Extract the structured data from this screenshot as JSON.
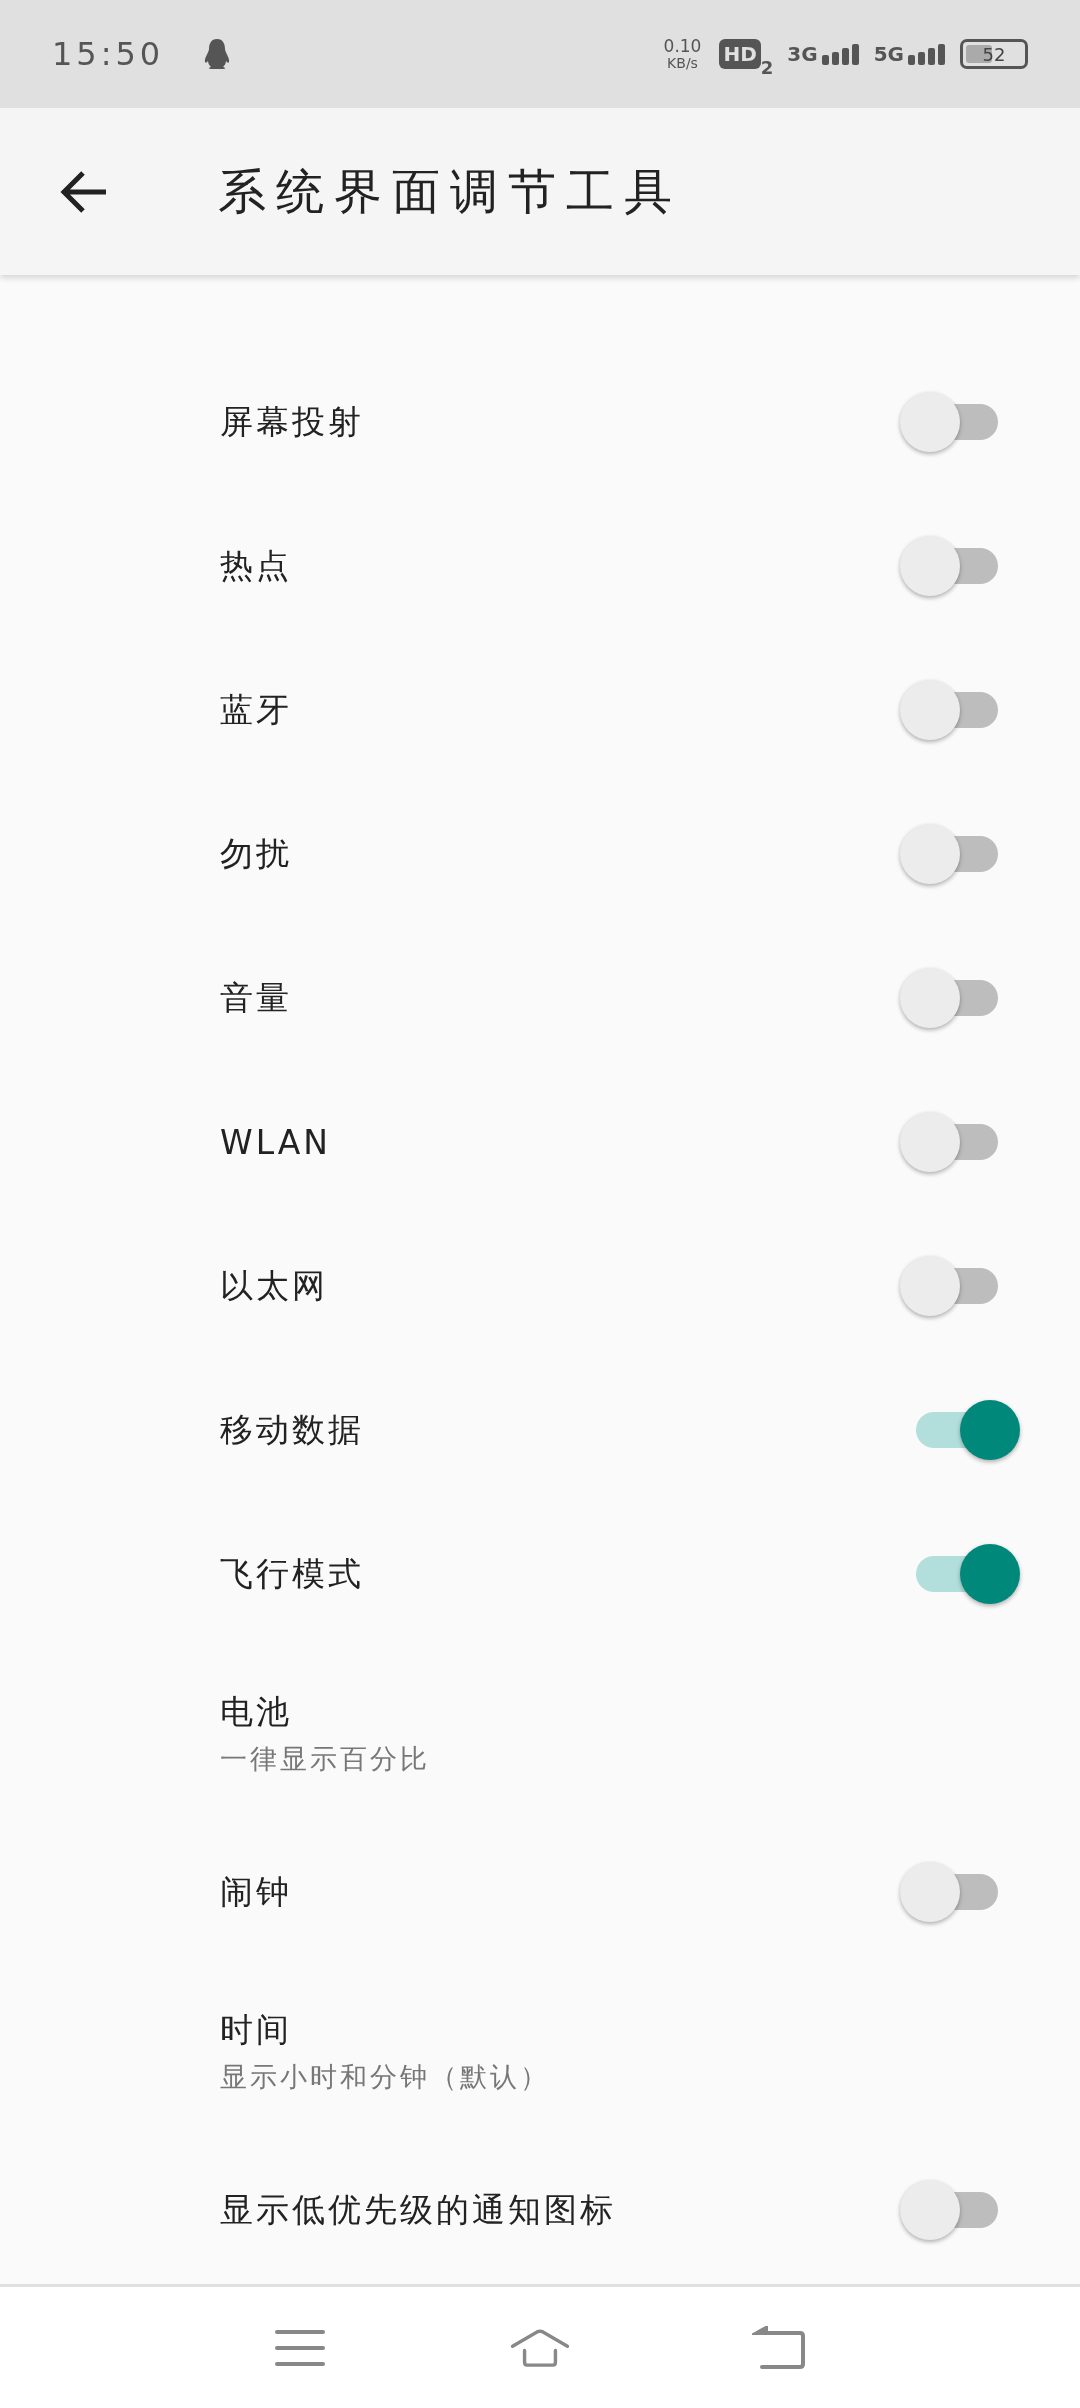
{
  "status_bar": {
    "time": "15:50",
    "speed_value": "0.10",
    "speed_unit": "KB/s",
    "hd": "HD",
    "hd_sub": "2",
    "network_1": "3G",
    "network_2": "5G",
    "battery": {
      "text": "52",
      "level": 0.52
    }
  },
  "header": {
    "title": "系统界面调节工具"
  },
  "rows": [
    {
      "kind": "toggle",
      "label": "屏幕投射",
      "on": false
    },
    {
      "kind": "toggle",
      "label": "热点",
      "on": false
    },
    {
      "kind": "toggle",
      "label": "蓝牙",
      "on": false
    },
    {
      "kind": "toggle",
      "label": "勿扰",
      "on": false
    },
    {
      "kind": "toggle",
      "label": "音量",
      "on": false
    },
    {
      "kind": "toggle",
      "label": "WLAN",
      "on": false
    },
    {
      "kind": "toggle",
      "label": "以太网",
      "on": false
    },
    {
      "kind": "toggle",
      "label": "移动数据",
      "on": true
    },
    {
      "kind": "toggle",
      "label": "飞行模式",
      "on": true
    },
    {
      "kind": "info",
      "label": "电池",
      "subtitle": "一律显示百分比"
    },
    {
      "kind": "toggle",
      "label": "闹钟",
      "on": false
    },
    {
      "kind": "info",
      "label": "时间",
      "subtitle": "显示小时和分钟（默认）"
    },
    {
      "kind": "toggle",
      "label": "显示低优先级的通知图标",
      "on": false
    }
  ]
}
